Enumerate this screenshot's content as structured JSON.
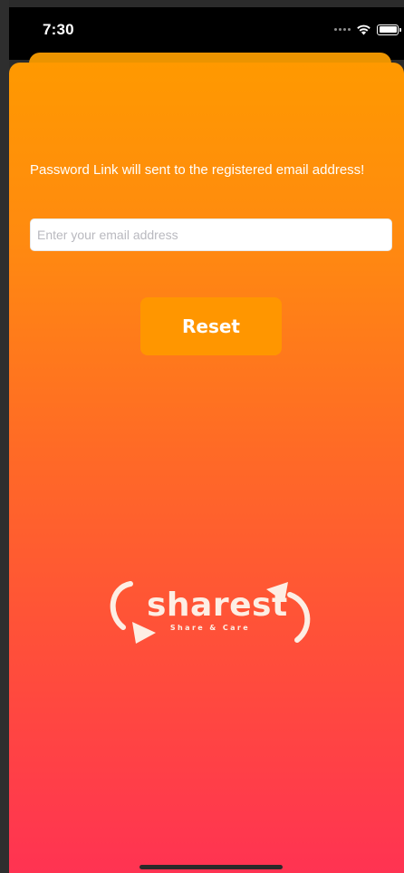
{
  "status_bar": {
    "time": "7:30"
  },
  "reset_form": {
    "info_text": "Password Link will sent to the registered email address!",
    "email_value": "",
    "email_placeholder": "Enter your email address",
    "reset_label": "Reset"
  },
  "logo": {
    "word": "sharest",
    "tagline": "Share & Care"
  },
  "colors": {
    "gradient_top": "#ff9900",
    "gradient_bottom": "#ff3352",
    "button": "#ff9600",
    "logo_text": "#fdeee4"
  },
  "icons": [
    "signal-icon",
    "wifi-icon",
    "battery-icon",
    "logo-arrow-left-icon",
    "logo-arrow-right-icon"
  ]
}
